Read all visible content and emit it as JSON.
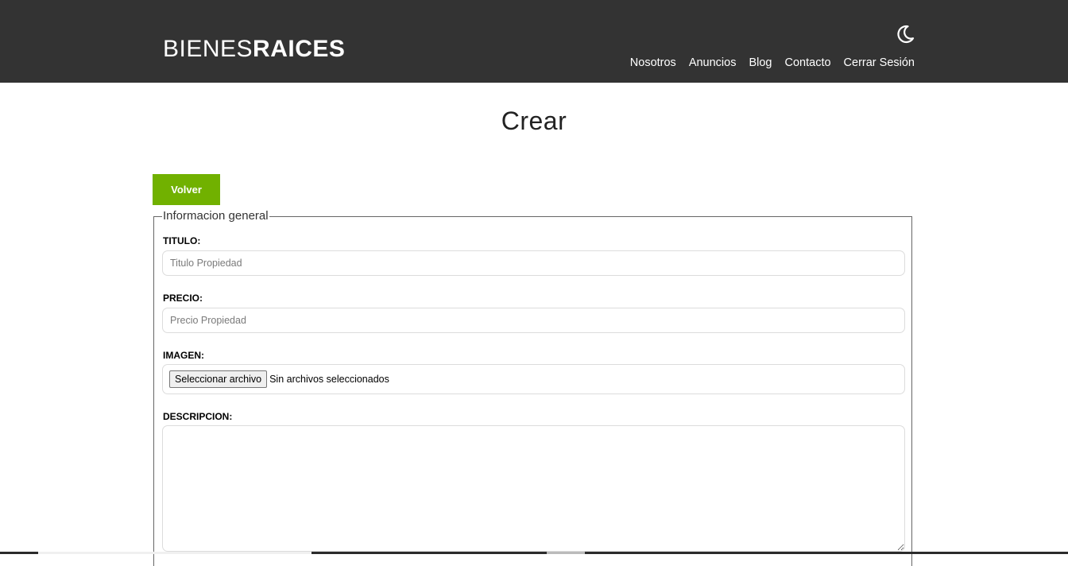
{
  "header": {
    "logo_light": "BIENES",
    "logo_bold": "RAICES",
    "theme_toggle_icon": "moon-icon",
    "nav": [
      "Nosotros",
      "Anuncios",
      "Blog",
      "Contacto",
      "Cerrar Sesión"
    ]
  },
  "main": {
    "title": "Crear",
    "back_button": "Volver",
    "back_button_color": "#71b100",
    "fieldset_legend": "Informacion general",
    "fields": {
      "titulo": {
        "label": "TITULO:",
        "placeholder": "Titulo Propiedad",
        "value": ""
      },
      "precio": {
        "label": "PRECIO:",
        "placeholder": "Precio Propiedad",
        "value": ""
      },
      "imagen": {
        "label": "IMAGEN:",
        "button": "Seleccionar archivo",
        "status": "Sin archivos seleccionados"
      },
      "descripcion": {
        "label": "DESCRIPCION:",
        "value": ""
      }
    }
  },
  "colors": {
    "header_bg": "#333333",
    "accent": "#71b100"
  }
}
